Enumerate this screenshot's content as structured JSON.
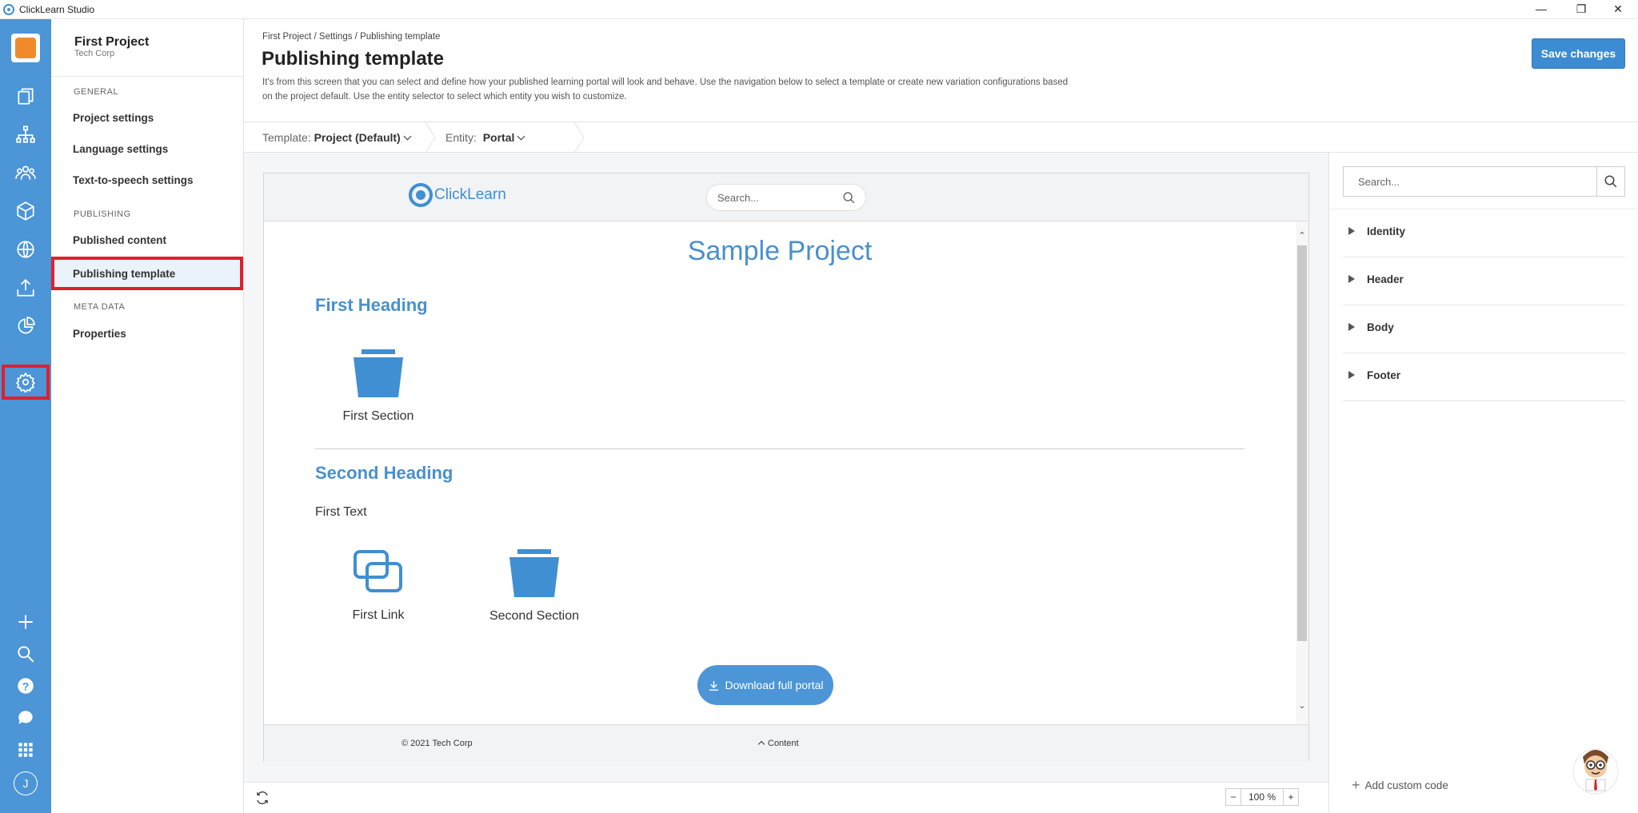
{
  "window": {
    "title": "ClickLearn Studio"
  },
  "project": {
    "name": "First Project",
    "org": "Tech Corp"
  },
  "sidebar": {
    "general_label": "GENERAL",
    "publishing_label": "PUBLISHING",
    "meta_label": "META DATA",
    "items": [
      {
        "label": "Project settings"
      },
      {
        "label": "Language settings"
      },
      {
        "label": "Text-to-speech settings"
      },
      {
        "label": "Published content"
      },
      {
        "label": "Publishing template"
      },
      {
        "label": "Properties"
      }
    ]
  },
  "rail": {
    "icons": [
      "documents-icon",
      "sitemap-icon",
      "users-icon",
      "package-icon",
      "globe-icon",
      "publish-icon",
      "chart-pie-icon",
      "settings-icon"
    ],
    "bottom_icons": [
      "plus-icon",
      "search-icon",
      "help-icon",
      "chat-icon",
      "apps-icon"
    ],
    "avatar_letter": "J"
  },
  "header": {
    "breadcrumb": "First Project / Settings / Publishing template",
    "title": "Publishing template",
    "description": "It's from this screen that you can select and define how your published learning portal will look and behave. Use the navigation below to select a template or create new variation configurations based on the project default. Use the entity selector to select which entity you wish to customize.",
    "save_label": "Save changes"
  },
  "toolbar": {
    "template_label": "Template:",
    "template_value": "Project (Default)",
    "entity_label": "Entity:",
    "entity_value": "Portal"
  },
  "preview": {
    "logo_text": "ClickLearn",
    "search_placeholder": "Search...",
    "title": "Sample Project",
    "heading1": "First Heading",
    "tile1": "First Section",
    "heading2": "Second Heading",
    "text1": "First Text",
    "tile2": "First Link",
    "tile3": "Second Section",
    "download_label": "Download full portal",
    "footer_copy": "© 2021 Tech Corp",
    "footer_content": "Content"
  },
  "bottombar": {
    "zoom": "100 %",
    "zoom_minus": "−",
    "zoom_plus": "+"
  },
  "right_panel": {
    "search_placeholder": "Search...",
    "sections": [
      {
        "label": "Identity"
      },
      {
        "label": "Header"
      },
      {
        "label": "Body"
      },
      {
        "label": "Footer"
      }
    ],
    "add_custom_code": "Add custom code"
  },
  "colors": {
    "accent": "#4c95d7",
    "highlight": "#e0202a",
    "save_button": "#3b8cd2"
  }
}
